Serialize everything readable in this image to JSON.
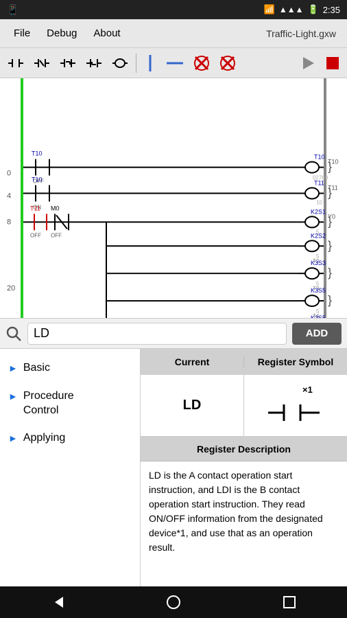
{
  "statusBar": {
    "time": "2:35",
    "batteryIcon": "🔋",
    "signalText": "signal"
  },
  "menuBar": {
    "items": [
      "File",
      "Debug",
      "About"
    ],
    "title": "Traffic-Light.gxw"
  },
  "toolbar": {
    "buttons": [
      {
        "name": "contact-no",
        "label": "┤├"
      },
      {
        "name": "contact-nc",
        "label": "┤/├"
      },
      {
        "name": "contact-pos",
        "label": "┤P├"
      },
      {
        "name": "contact-neg",
        "label": "┤N├"
      },
      {
        "name": "coil",
        "label": "( )"
      },
      {
        "name": "vertical-line",
        "label": "|"
      },
      {
        "name": "horizontal-line",
        "label": "—"
      },
      {
        "name": "delete-x",
        "label": "✕"
      },
      {
        "name": "delete-x2",
        "label": "✕"
      },
      {
        "name": "run-btn",
        "label": "▶"
      },
      {
        "name": "stop-btn",
        "label": "■"
      }
    ]
  },
  "search": {
    "value": "LD",
    "placeholder": "Search",
    "addLabel": "ADD"
  },
  "leftNav": {
    "items": [
      {
        "name": "basic",
        "label": "Basic"
      },
      {
        "name": "procedure-control",
        "label": "Procedure Control"
      },
      {
        "name": "applying",
        "label": "Applying"
      }
    ]
  },
  "registerPanel": {
    "columns": [
      "Current",
      "Register Symbol"
    ],
    "currentValue": "LD",
    "symbolX1": "×1",
    "descriptionHeader": "Register Description",
    "descriptionText": "LD is the A contact operation start instruction, and LDI is the B contact operation start instruction. They read ON/OFF information from the designated device*1, and use that as an operation result."
  }
}
